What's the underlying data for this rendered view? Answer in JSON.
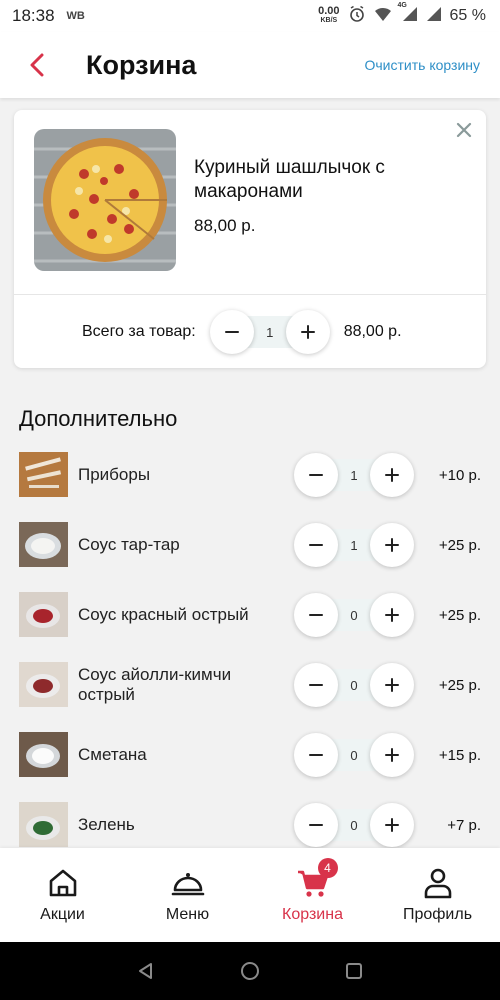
{
  "status": {
    "time": "18:38",
    "carrier": "WB",
    "speed_value": "0.00",
    "speed_unit": "KB/S",
    "network": "4G",
    "battery": "65 %"
  },
  "header": {
    "title": "Корзина",
    "clear_label": "Очистить корзину"
  },
  "product": {
    "name": "Куриный шашлычок с макаронами",
    "price": "88,00 р.",
    "total_label": "Всего за товар:",
    "quantity": "1",
    "total_price": "88,00 р."
  },
  "extras": {
    "title": "Дополнительно",
    "items": [
      {
        "name": "Приборы",
        "quantity": "1",
        "price": "+10 р."
      },
      {
        "name": "Соус тар-тар",
        "quantity": "1",
        "price": "+25 р."
      },
      {
        "name": "Соус красный острый",
        "quantity": "0",
        "price": "+25 р."
      },
      {
        "name": "Соус айолли-кимчи острый",
        "quantity": "0",
        "price": "+25 р."
      },
      {
        "name": "Сметана",
        "quantity": "0",
        "price": "+15 р."
      },
      {
        "name": "Зелень",
        "quantity": "0",
        "price": "+7 р."
      }
    ]
  },
  "nav": {
    "items": [
      {
        "label": "Акции",
        "icon": "home-icon"
      },
      {
        "label": "Меню",
        "icon": "cloche-icon"
      },
      {
        "label": "Корзина",
        "icon": "cart-icon",
        "badge": "4"
      },
      {
        "label": "Профиль",
        "icon": "user-icon"
      }
    ]
  },
  "colors": {
    "accent": "#d8334a",
    "link": "#2e8fc7",
    "background": "#f2f2f2"
  }
}
